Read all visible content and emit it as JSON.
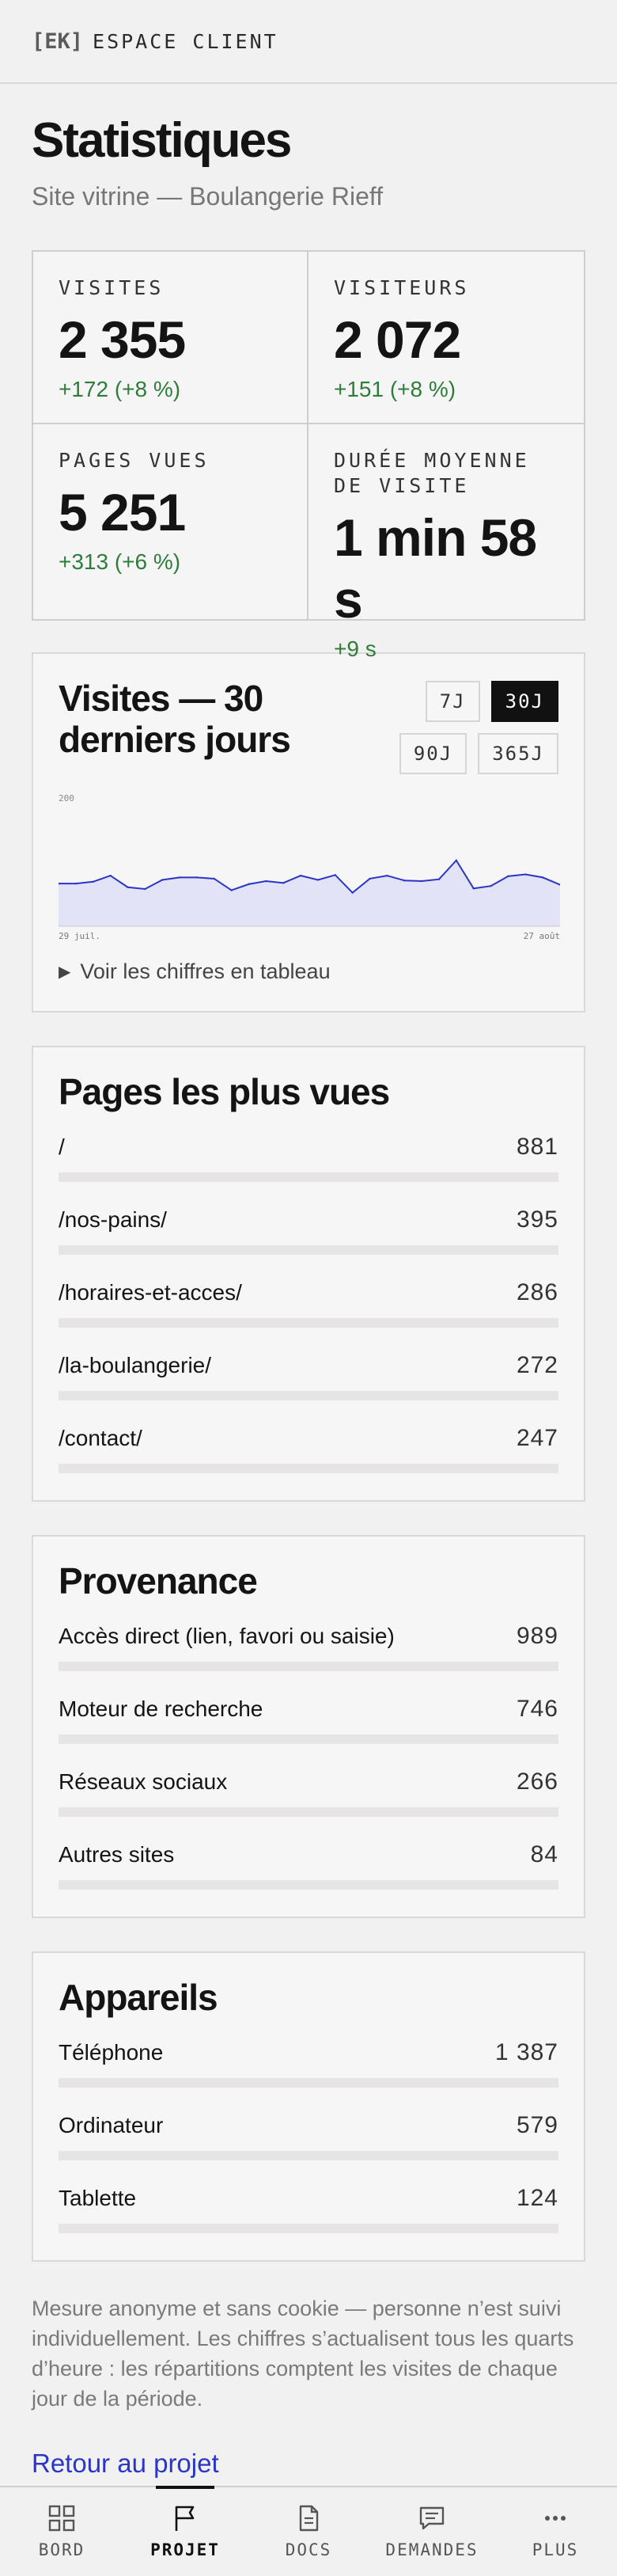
{
  "header": {
    "logo": "[EK]",
    "title": "ESPACE CLIENT"
  },
  "page": {
    "title": "Statistiques",
    "subtitle": "Site vitrine — Boulangerie Rieff"
  },
  "kpis": [
    {
      "label": "VISITES",
      "value": "2 355",
      "delta": "+172 (+8 %)"
    },
    {
      "label": "VISITEURS",
      "value": "2 072",
      "delta": "+151 (+8 %)"
    },
    {
      "label": "PAGES VUES",
      "value": "5 251",
      "delta": "+313 (+6 %)"
    },
    {
      "label": "DURÉE MOYENNE DE VISITE",
      "value": "1 min 58 s",
      "delta": "+9 s"
    }
  ],
  "visits_chart": {
    "title": "Visites — 30 derniers jours",
    "ranges": [
      "7J",
      "30J",
      "90J",
      "365J"
    ],
    "active_range": "30J",
    "toggle_label": "Voir les chiffres en tableau",
    "toggle_icon": "triangle-right-icon"
  },
  "chart_data": {
    "type": "area",
    "y_tick_label": "200",
    "x_start_label": "29 juil.",
    "x_end_label": "27 août",
    "ylim": [
      0,
      200
    ],
    "x": [
      "29 juil.",
      "30 juil.",
      "31 juil.",
      "1 août",
      "2 août",
      "3 août",
      "4 août",
      "5 août",
      "6 août",
      "7 août",
      "8 août",
      "9 août",
      "10 août",
      "11 août",
      "12 août",
      "13 août",
      "14 août",
      "15 août",
      "16 août",
      "17 août",
      "18 août",
      "19 août",
      "20 août",
      "21 août",
      "22 août",
      "23 août",
      "24 août",
      "25 août",
      "26 août",
      "27 août"
    ],
    "values": [
      70,
      70,
      73,
      83,
      64,
      61,
      76,
      80,
      80,
      78,
      59,
      69,
      74,
      71,
      83,
      76,
      84,
      55,
      78,
      83,
      75,
      74,
      77,
      108,
      62,
      66,
      82,
      85,
      80,
      68
    ],
    "color": "#2b35c4",
    "fill_color": "#e3e3f7",
    "grid": false
  },
  "top_pages": {
    "title": "Pages les plus vues",
    "items": [
      {
        "label": "/",
        "value": "881",
        "num": 881
      },
      {
        "label": "/nos-pains/",
        "value": "395",
        "num": 395
      },
      {
        "label": "/horaires-et-acces/",
        "value": "286",
        "num": 286
      },
      {
        "label": "/la-boulangerie/",
        "value": "272",
        "num": 272
      },
      {
        "label": "/contact/",
        "value": "247",
        "num": 247
      }
    ]
  },
  "sources": {
    "title": "Provenance",
    "items": [
      {
        "label": "Accès direct (lien, favori ou saisie)",
        "value": "989",
        "num": 989
      },
      {
        "label": "Moteur de recherche",
        "value": "746",
        "num": 746
      },
      {
        "label": "Réseaux sociaux",
        "value": "266",
        "num": 266
      },
      {
        "label": "Autres sites",
        "value": "84",
        "num": 84
      }
    ]
  },
  "devices": {
    "title": "Appareils",
    "items": [
      {
        "label": "Téléphone",
        "value": "1 387",
        "num": 1387
      },
      {
        "label": "Ordinateur",
        "value": "579",
        "num": 579
      },
      {
        "label": "Tablette",
        "value": "124",
        "num": 124
      }
    ]
  },
  "footnote": "Mesure anonyme et sans cookie — personne n’est suivi individuellement. Les chiffres s’actualisent tous les quarts d’heure : les répartitions comptent les visites de chaque jour de la période.",
  "back_link": "Retour au projet",
  "bottom_nav": [
    {
      "label": "BORD",
      "icon": "grid-icon",
      "active": false
    },
    {
      "label": "PROJET",
      "icon": "flag-icon",
      "active": true
    },
    {
      "label": "DOCS",
      "icon": "document-icon",
      "active": false
    },
    {
      "label": "DEMANDES",
      "icon": "chat-bubble-icon",
      "active": false
    },
    {
      "label": "PLUS",
      "icon": "more-dots-icon",
      "active": false
    }
  ]
}
